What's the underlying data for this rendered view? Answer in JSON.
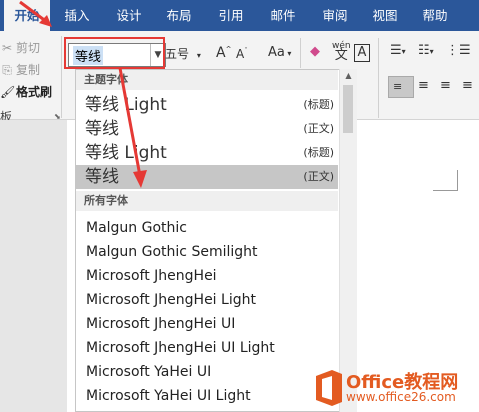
{
  "ribbon": {
    "tabs": [
      "开始",
      "插入",
      "设计",
      "布局",
      "引用",
      "邮件",
      "审阅",
      "视图",
      "帮助"
    ],
    "active_tab": "开始"
  },
  "clipboard": {
    "cut": "剪切",
    "copy": "复制",
    "format_painter": "格式刷",
    "group_label": "板"
  },
  "font_box": {
    "value": "等线"
  },
  "font_size": {
    "value": "五号"
  },
  "font_buttons": {
    "grow": "A",
    "shrink": "A",
    "case": "Aa",
    "pinyin": "wén",
    "border": "A"
  },
  "dropdown": {
    "theme_header": "主题字体",
    "theme_fonts": [
      {
        "name": "等线 Light",
        "tag": "(标题)"
      },
      {
        "name": "等线",
        "tag": "(正文)"
      },
      {
        "name": "等线 Light",
        "tag": "(标题)"
      },
      {
        "name": "等线",
        "tag": "(正文)"
      }
    ],
    "all_header": "所有字体",
    "all_fonts": [
      "Malgun Gothic",
      "Malgun Gothic Semilight",
      "Microsoft JhengHei",
      "Microsoft JhengHei Light",
      "Microsoft JhengHei UI",
      "Microsoft JhengHei UI Light",
      "Microsoft YaHei UI",
      "Microsoft YaHei UI Light"
    ]
  },
  "logo": {
    "name": "Office教程网",
    "url": "www.office26.com"
  },
  "colors": {
    "ribbon_blue": "#2b579a",
    "annotation_red": "#e53935",
    "selection_gray": "#c6c6c6"
  }
}
